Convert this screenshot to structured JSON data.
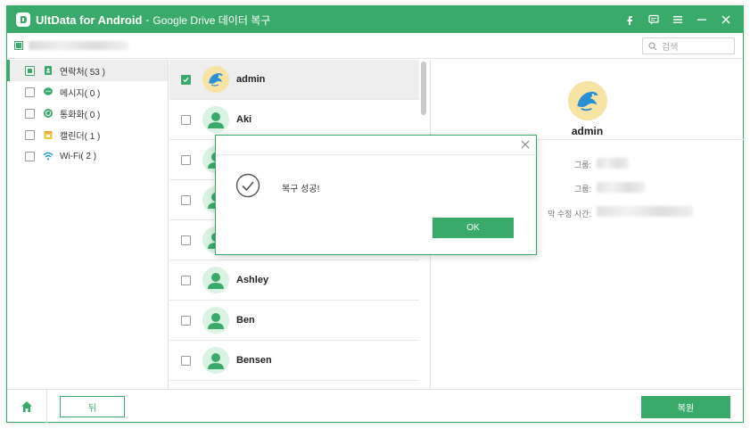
{
  "titlebar": {
    "app_name": "UltData for Android",
    "separator": "-",
    "subtitle": "Google Drive 데이터 복구",
    "icons": [
      "facebook-icon",
      "feedback-icon",
      "menu-icon",
      "minimize-icon",
      "close-icon"
    ]
  },
  "toolbar": {
    "search_placeholder": "검색"
  },
  "sidebar": {
    "items": [
      {
        "label": "연락처( 53 )",
        "icon": "contacts-icon",
        "active": true
      },
      {
        "label": "메시지( 0 )",
        "icon": "message-icon",
        "active": false
      },
      {
        "label": "통화화( 0 )",
        "icon": "call-icon",
        "active": false
      },
      {
        "label": "캘린더( 1 )",
        "icon": "calendar-icon",
        "active": false
      },
      {
        "label": "Wi-Fi( 2 )",
        "icon": "wifi-icon",
        "active": false
      }
    ]
  },
  "contacts": [
    {
      "name": "admin",
      "checked": true,
      "avatar": "dolphin"
    },
    {
      "name": "Aki",
      "checked": false,
      "avatar": "person"
    },
    {
      "name": "",
      "checked": false,
      "avatar": "person"
    },
    {
      "name": "",
      "checked": false,
      "avatar": "person"
    },
    {
      "name": "",
      "checked": false,
      "avatar": "person"
    },
    {
      "name": "Ashley",
      "checked": false,
      "avatar": "person"
    },
    {
      "name": "Ben",
      "checked": false,
      "avatar": "person"
    },
    {
      "name": "Bensen",
      "checked": false,
      "avatar": "person"
    }
  ],
  "detail": {
    "name": "admin",
    "label_group_1": "그룹:",
    "label_group_2": "그룹:",
    "label_modified": "막 수정 시간:"
  },
  "bottombar": {
    "back_label": "뒤",
    "recover_label": "복원"
  },
  "dialog": {
    "message": "복구 성공!",
    "ok_label": "OK"
  },
  "colors": {
    "accent": "#3aaa6b",
    "selected_row": "#eeeeee"
  }
}
